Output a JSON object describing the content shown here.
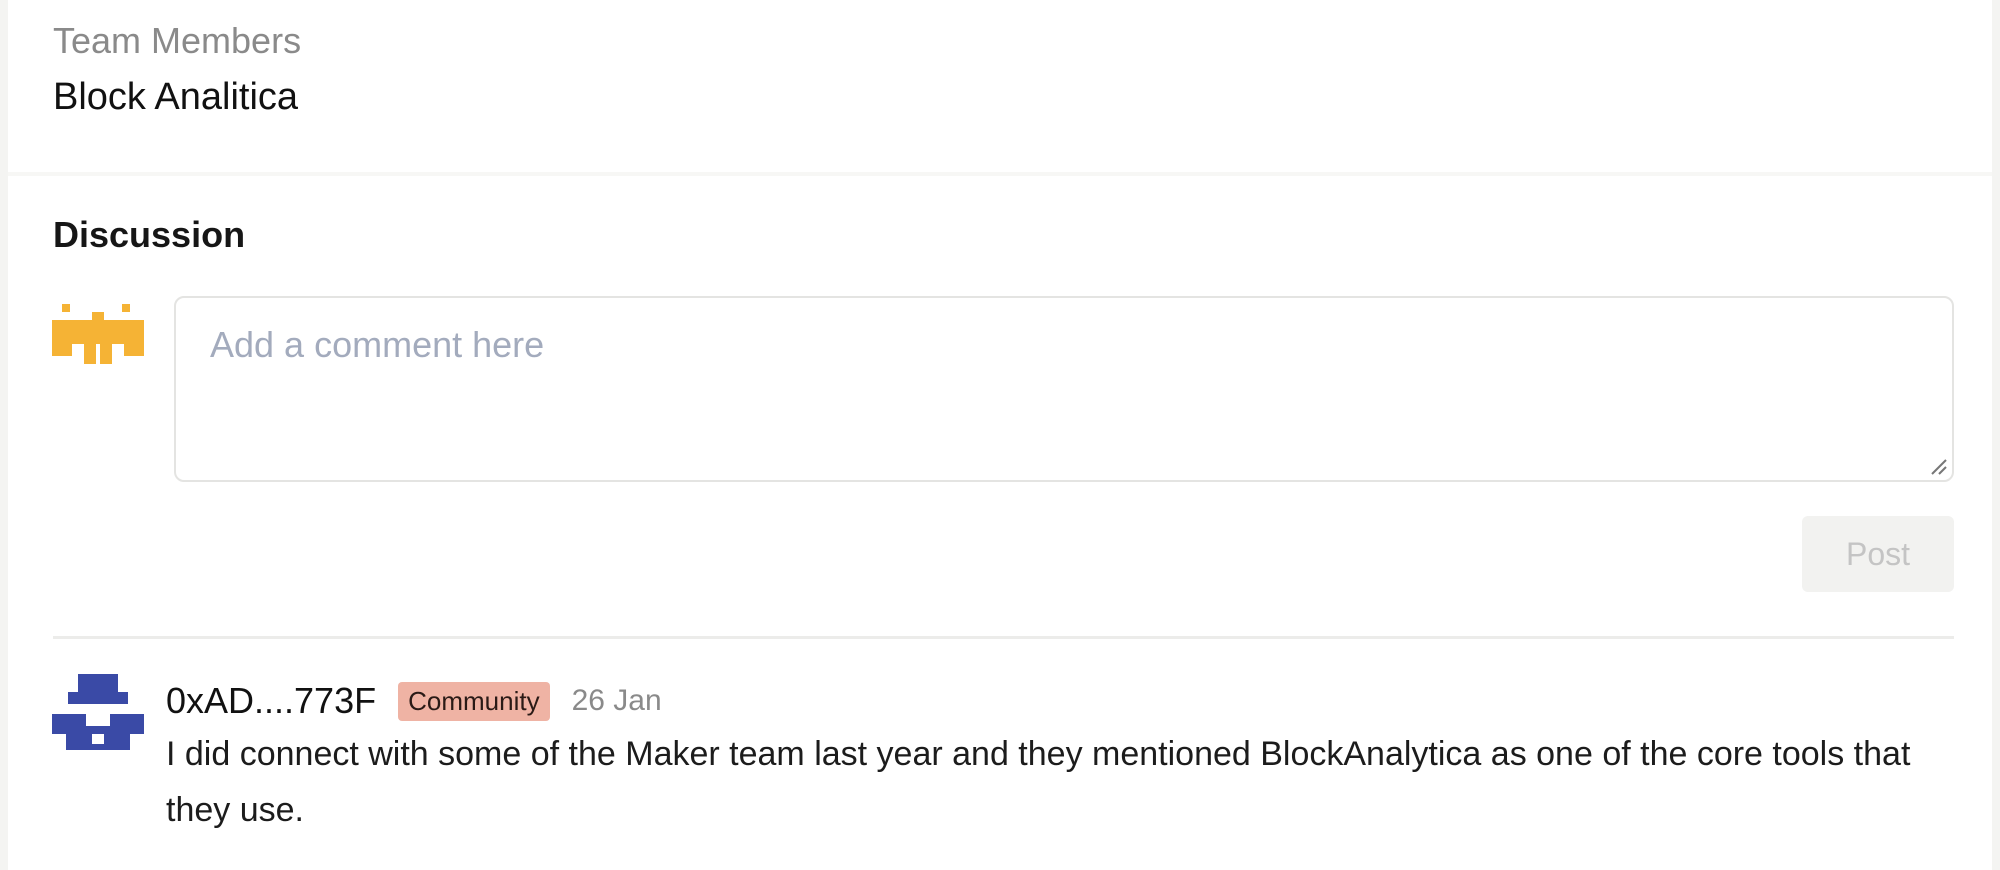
{
  "team": {
    "label": "Team Members",
    "value": "Block Analitica"
  },
  "discussion": {
    "title": "Discussion",
    "comment_input": {
      "placeholder": "Add a comment here",
      "value": ""
    },
    "post_label": "Post",
    "current_user_avatar_icon": "orange-robot-avatar-icon",
    "comments": [
      {
        "author": "0xAD....773F",
        "badge": "Community",
        "date": "26 Jan",
        "avatar_icon": "blue-robot-avatar-icon",
        "text": "I did connect with some of the Maker team last year and they mentioned BlockAnalytica as one of the core tools that they use."
      }
    ]
  },
  "colors": {
    "badge_bg": "#efb3a4",
    "avatar_orange": "#f5b335",
    "avatar_blue": "#3a4aa6",
    "placeholder": "#a3abbd"
  }
}
